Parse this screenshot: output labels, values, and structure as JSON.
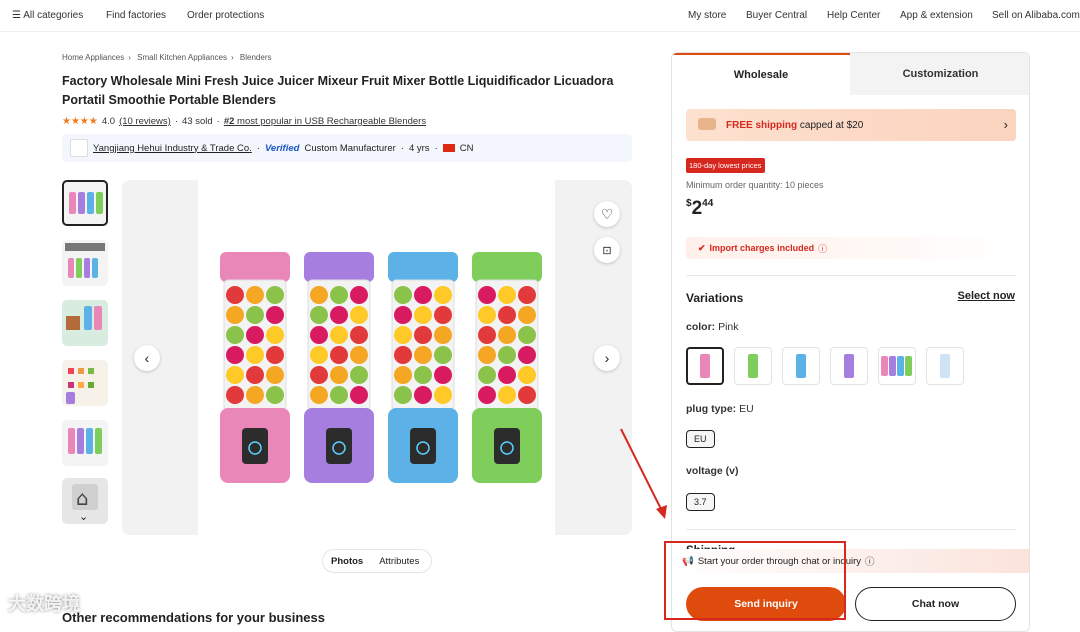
{
  "topnav": {
    "all_categories": "All categories",
    "find_factories": "Find factories",
    "order_protections": "Order protections",
    "my_store": "My store",
    "buyer_central": "Buyer Central",
    "help_center": "Help Center",
    "app_extension": "App & extension",
    "sell_on": "Sell on Alibaba.com"
  },
  "breadcrumb": [
    "Home Appliances",
    "Small Kitchen Appliances",
    "Blenders"
  ],
  "product": {
    "title": "Factory Wholesale Mini Fresh Juice Juicer Mixeur Fruit Mixer Bottle Liquidificador Licuadora Portatil Smoothie Portable Blenders",
    "rating": "4.0",
    "stars": "★★★★",
    "reviews": "(10 reviews)",
    "sold": "43 sold",
    "rank_prefix": "#2",
    "rank_text": "most popular in USB Rechargeable Blenders"
  },
  "supplier": {
    "name": "Yangjiang Hehui Industry & Trade Co.",
    "verified": "Verified",
    "type": "Custom Manufacturer",
    "years": "4 yrs",
    "country": "CN"
  },
  "gallery": {
    "tab_photos": "Photos",
    "tab_attributes": "Attributes",
    "thumb_count": 6,
    "blender_colors": [
      "#e987b9",
      "#a57ee0",
      "#5cb2e6",
      "#7fce5b"
    ]
  },
  "other_recommendations": "Other recommendations for your business",
  "panel": {
    "tab_wholesale": "Wholesale",
    "tab_customization": "Customization",
    "shipping_free": "FREE shipping",
    "shipping_rest": "capped at $20",
    "badge": "180-day lowest prices",
    "moq": "Minimum order quantity: 10 pieces",
    "price_currency": "$",
    "price_whole": "2",
    "price_cents": "44",
    "import_charges": "Import charges included",
    "variations": "Variations",
    "select_now": "Select now",
    "color_label": "color:",
    "color_value": "Pink",
    "plug_label": "plug type:",
    "plug_value": "EU",
    "plug_option": "EU",
    "voltage_label": "voltage (v)",
    "voltage_option": "3.7",
    "shipping_heading": "Shipping",
    "chat_notice": "Start your order through chat or inquiry",
    "send_inquiry": "Send inquiry",
    "chat_now": "Chat now"
  },
  "watermark": "大数跨境",
  "colors": {
    "accent": "#de4b0d",
    "badge_red": "#d6281f",
    "star": "#f27a1a"
  }
}
